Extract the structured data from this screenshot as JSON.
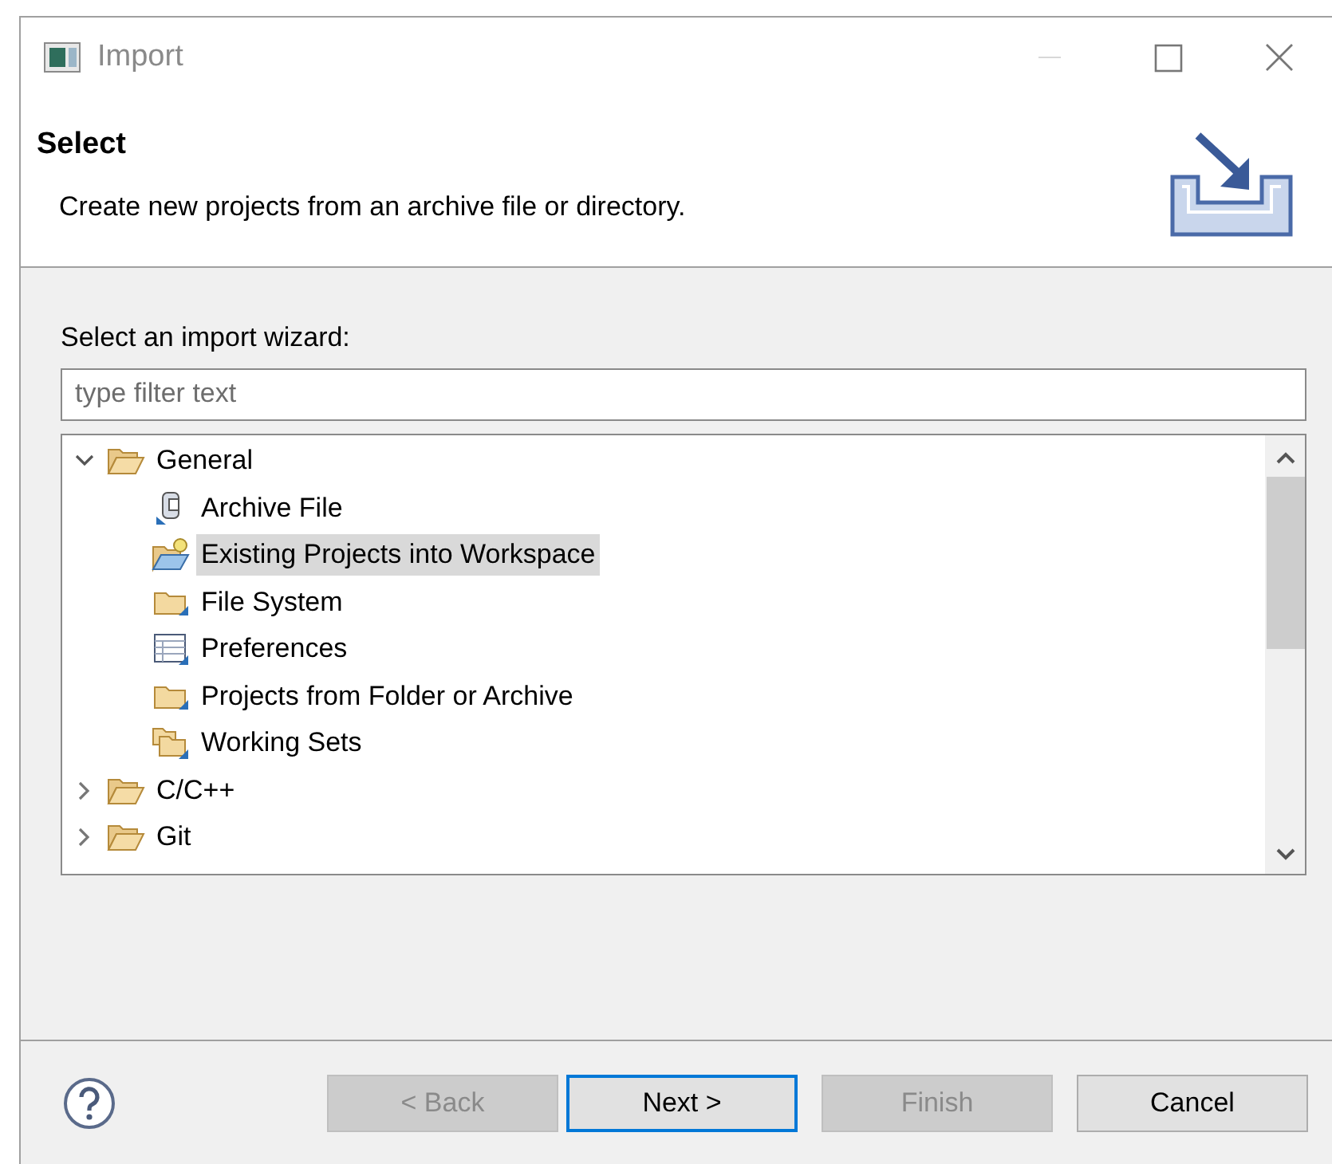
{
  "window": {
    "title": "Import"
  },
  "header": {
    "title": "Select",
    "description": "Create new projects from an archive file or directory."
  },
  "wizard_label": "Select an import wizard:",
  "filter": {
    "placeholder": "type filter text"
  },
  "tree": [
    {
      "label": "General",
      "expanded": true,
      "selected": false,
      "children": [
        {
          "label": "Archive File",
          "selected": false
        },
        {
          "label": "Existing Projects into Workspace",
          "selected": true
        },
        {
          "label": "File System",
          "selected": false
        },
        {
          "label": "Preferences",
          "selected": false
        },
        {
          "label": "Projects from Folder or Archive",
          "selected": false
        },
        {
          "label": "Working Sets",
          "selected": false
        }
      ]
    },
    {
      "label": "C/C++",
      "expanded": false,
      "selected": false
    },
    {
      "label": "Git",
      "expanded": false,
      "selected": false
    }
  ],
  "buttons": [
    {
      "label": "< Back",
      "disabled": true,
      "default": false
    },
    {
      "label": "Next >",
      "disabled": false,
      "default": true
    },
    {
      "label": "Finish",
      "disabled": true,
      "default": false
    },
    {
      "label": "Cancel",
      "disabled": false,
      "default": false
    }
  ]
}
